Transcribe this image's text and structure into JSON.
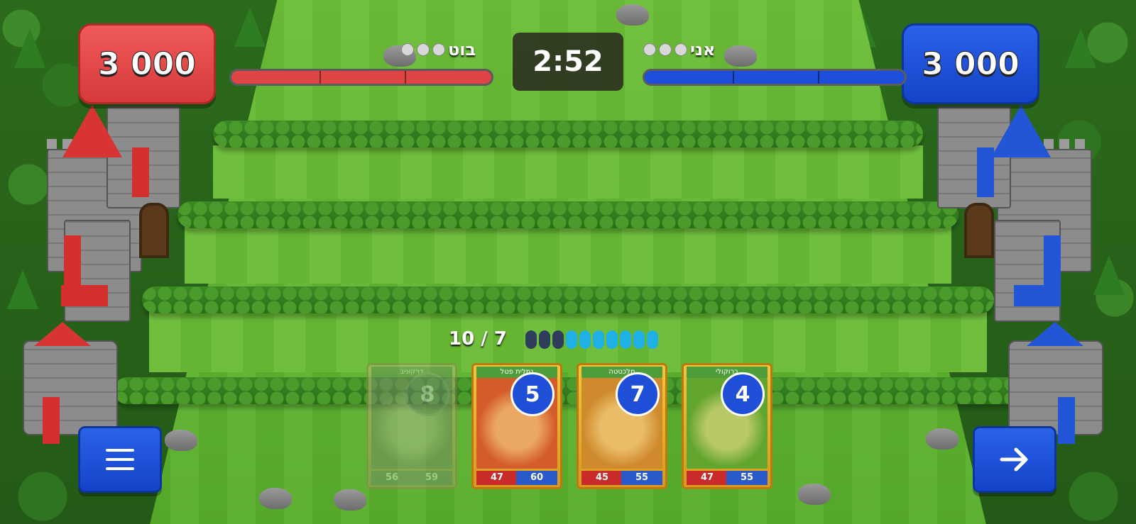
{
  "colors": {
    "red_team": "#e04545",
    "blue_team": "#1d4fdb",
    "grass": "#64b833",
    "energy_empty": "#2e3e5a",
    "energy_full": "#1fb0e6"
  },
  "opponent": {
    "name": "בוט",
    "score": "3 000",
    "health_fraction": 1.0
  },
  "player": {
    "name": "אני",
    "score": "3 000",
    "health_fraction": 1.0
  },
  "timer": "2:52",
  "energy": {
    "label": "10 / 7",
    "total_pips": 10,
    "spent_pips": 3
  },
  "hand": [
    {
      "name": "דרקוניב",
      "cost": "8",
      "attack": "56",
      "defense": "59",
      "playable": false,
      "art_color": "#8a8a64"
    },
    {
      "name": "נמלית פטל",
      "cost": "5",
      "attack": "47",
      "defense": "60",
      "playable": true,
      "art_color": "#d35c2a"
    },
    {
      "name": "מלכטטה",
      "cost": "7",
      "attack": "45",
      "defense": "55",
      "playable": true,
      "art_color": "#d08a2e"
    },
    {
      "name": "ברוקולי",
      "cost": "4",
      "attack": "47",
      "defense": "55",
      "playable": true,
      "art_color": "#62a52e"
    }
  ],
  "buttons": {
    "menu_icon": "menu-icon",
    "next_icon": "arrow-right-icon"
  }
}
